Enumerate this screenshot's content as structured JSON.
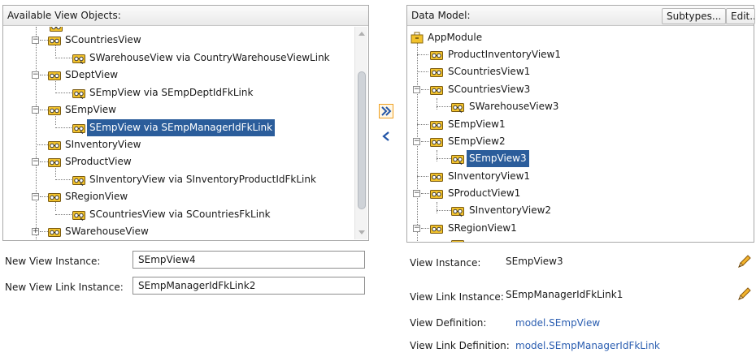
{
  "left_panel": {
    "header": "Available View Objects:",
    "items": [
      {
        "label": "SCountriesView",
        "selected": false
      },
      {
        "label": "SWarehouseView via CountryWarehouseViewLink",
        "selected": false
      },
      {
        "label": "SDeptView",
        "selected": false
      },
      {
        "label": "SEmpView via SEmpDeptIdFkLink",
        "selected": false
      },
      {
        "label": "SEmpView",
        "selected": false
      },
      {
        "label": "SEmpView via SEmpManagerIdFkLink",
        "selected": true
      },
      {
        "label": "SInventoryView",
        "selected": false
      },
      {
        "label": "SProductView",
        "selected": false
      },
      {
        "label": "SInventoryView via SInventoryProductIdFkLink",
        "selected": false
      },
      {
        "label": "SRegionView",
        "selected": false
      },
      {
        "label": "SCountriesView via SCountriesFkLink",
        "selected": false
      },
      {
        "label": "SWarehouseView",
        "selected": false
      }
    ],
    "scroll_position": 0.55
  },
  "fields": {
    "new_view_instance_label": "New View Instance:",
    "new_view_instance_value": "SEmpView4",
    "new_view_link_instance_label": "New View Link Instance:",
    "new_view_link_instance_value": "SEmpManagerIdFkLink2"
  },
  "move_buttons": {
    "add_icon": "double-chevron-right-icon",
    "remove_icon": "chevron-left-icon"
  },
  "right_panel": {
    "header": "Data Model:",
    "subtypes_label": "Subtypes...",
    "edit_label": "Edit...",
    "root": "AppModule",
    "items": [
      {
        "label": "ProductInventoryView1",
        "selected": false
      },
      {
        "label": "SCountriesView1",
        "selected": false
      },
      {
        "label": "SCountriesView3",
        "selected": false
      },
      {
        "label": "SWarehouseView3",
        "selected": false
      },
      {
        "label": "SEmpView1",
        "selected": false
      },
      {
        "label": "SEmpView2",
        "selected": false
      },
      {
        "label": "SEmpView3",
        "selected": true
      },
      {
        "label": "SInventoryView1",
        "selected": false
      },
      {
        "label": "SProductView1",
        "selected": false
      },
      {
        "label": "SInventoryView2",
        "selected": false
      },
      {
        "label": "SRegionView1",
        "selected": false
      }
    ]
  },
  "details": {
    "view_instance_label": "View Instance:",
    "view_instance_value": "SEmpView3",
    "view_link_instance_label": "View Link Instance:",
    "view_link_instance_value": "SEmpManagerIdFkLink1",
    "view_definition_label": "View Definition:",
    "view_definition_value": "model.SEmpView",
    "view_link_definition_label": "View Link Definition:",
    "view_link_definition_value": "model.SEmpManagerIdFkLink",
    "edit_icon": "pencil-icon"
  },
  "colors": {
    "selection": "#2b5d9b",
    "link": "#2a5db0",
    "icon_yellow": "#f2c22c",
    "move_button_border": "#f0a020"
  }
}
